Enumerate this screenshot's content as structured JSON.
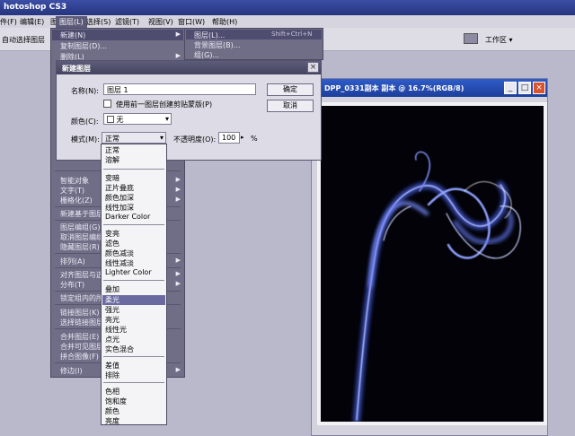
{
  "app": {
    "title": "hotoshop CS3"
  },
  "menubar": {
    "items": [
      "件(F)",
      "编辑(E)",
      "图像(I)",
      "图层(L)",
      "选择(S)",
      "滤镜(T)",
      "视图(V)",
      "窗口(W)",
      "帮助(H)"
    ]
  },
  "optionsbar": {
    "auto_select": "自动选择图层",
    "workspace": "工作区 ▾"
  },
  "layer_menu": {
    "items": [
      {
        "label": "新建(N)",
        "arrow": true
      },
      {
        "label": "复制图层(D)...",
        "arrow": false
      },
      {
        "label": "删除(L)",
        "arrow": true
      },
      {
        "label": "智能对象",
        "arrow": true
      },
      {
        "label": "文字(T)",
        "arrow": true
      },
      {
        "label": "栅格化(Z)",
        "arrow": true
      },
      {
        "label": "新建基于图层的",
        "arrow": false
      },
      {
        "label": "图层编组(G)",
        "arrow": false
      },
      {
        "label": "取消图层编组",
        "arrow": false
      },
      {
        "label": "隐藏图层(R)",
        "arrow": false
      },
      {
        "label": "排列(A)",
        "arrow": true
      },
      {
        "label": "对齐图层与选区",
        "arrow": true
      },
      {
        "label": "分布(T)",
        "arrow": true
      },
      {
        "label": "锁定组内的所有",
        "arrow": false
      },
      {
        "label": "链接图层(K)",
        "arrow": false
      },
      {
        "label": "选择链接图层",
        "arrow": false
      },
      {
        "label": "合并图层(E)",
        "arrow": false
      },
      {
        "label": "合并可见图层",
        "arrow": false
      },
      {
        "label": "拼合图像(F)",
        "arrow": false
      },
      {
        "label": "修边(I)",
        "arrow": true
      }
    ]
  },
  "new_submenu": {
    "items": [
      "图层(L)...",
      "背景图层(B)...",
      "组(G)..."
    ],
    "shortcut": "Shift+Ctrl+N"
  },
  "dialog": {
    "title": "新建图层",
    "name_label": "名称(N):",
    "name_value": "图层 1",
    "clip_checkbox": "使用前一图层创建剪贴蒙版(P)",
    "color_label": "颜色(C):",
    "color_value": "无",
    "mode_label": "模式(M):",
    "mode_value": "正常",
    "opacity_label": "不透明度(O):",
    "opacity_value": "100",
    "opacity_unit": "%",
    "ok": "确定",
    "cancel": "取消"
  },
  "blend_modes": {
    "groups": [
      [
        "正常",
        "溶解"
      ],
      [
        "变暗",
        "正片叠底",
        "颜色加深",
        "线性加深",
        "Darker Color"
      ],
      [
        "变亮",
        "滤色",
        "颜色减淡",
        "线性减淡",
        "Lighter Color"
      ],
      [
        "叠加",
        "柔光",
        "强光",
        "亮光",
        "线性光",
        "点光",
        "实色混合"
      ],
      [
        "差值",
        "排除"
      ],
      [
        "色相",
        "饱和度",
        "颜色",
        "亮度"
      ]
    ],
    "highlighted": "柔光"
  },
  "document": {
    "title": "DPP_0331副本 副本 @ 16.7%(RGB/8)"
  },
  "colors": {
    "smoke": "#5a6ed8",
    "canvas": "#020208"
  }
}
